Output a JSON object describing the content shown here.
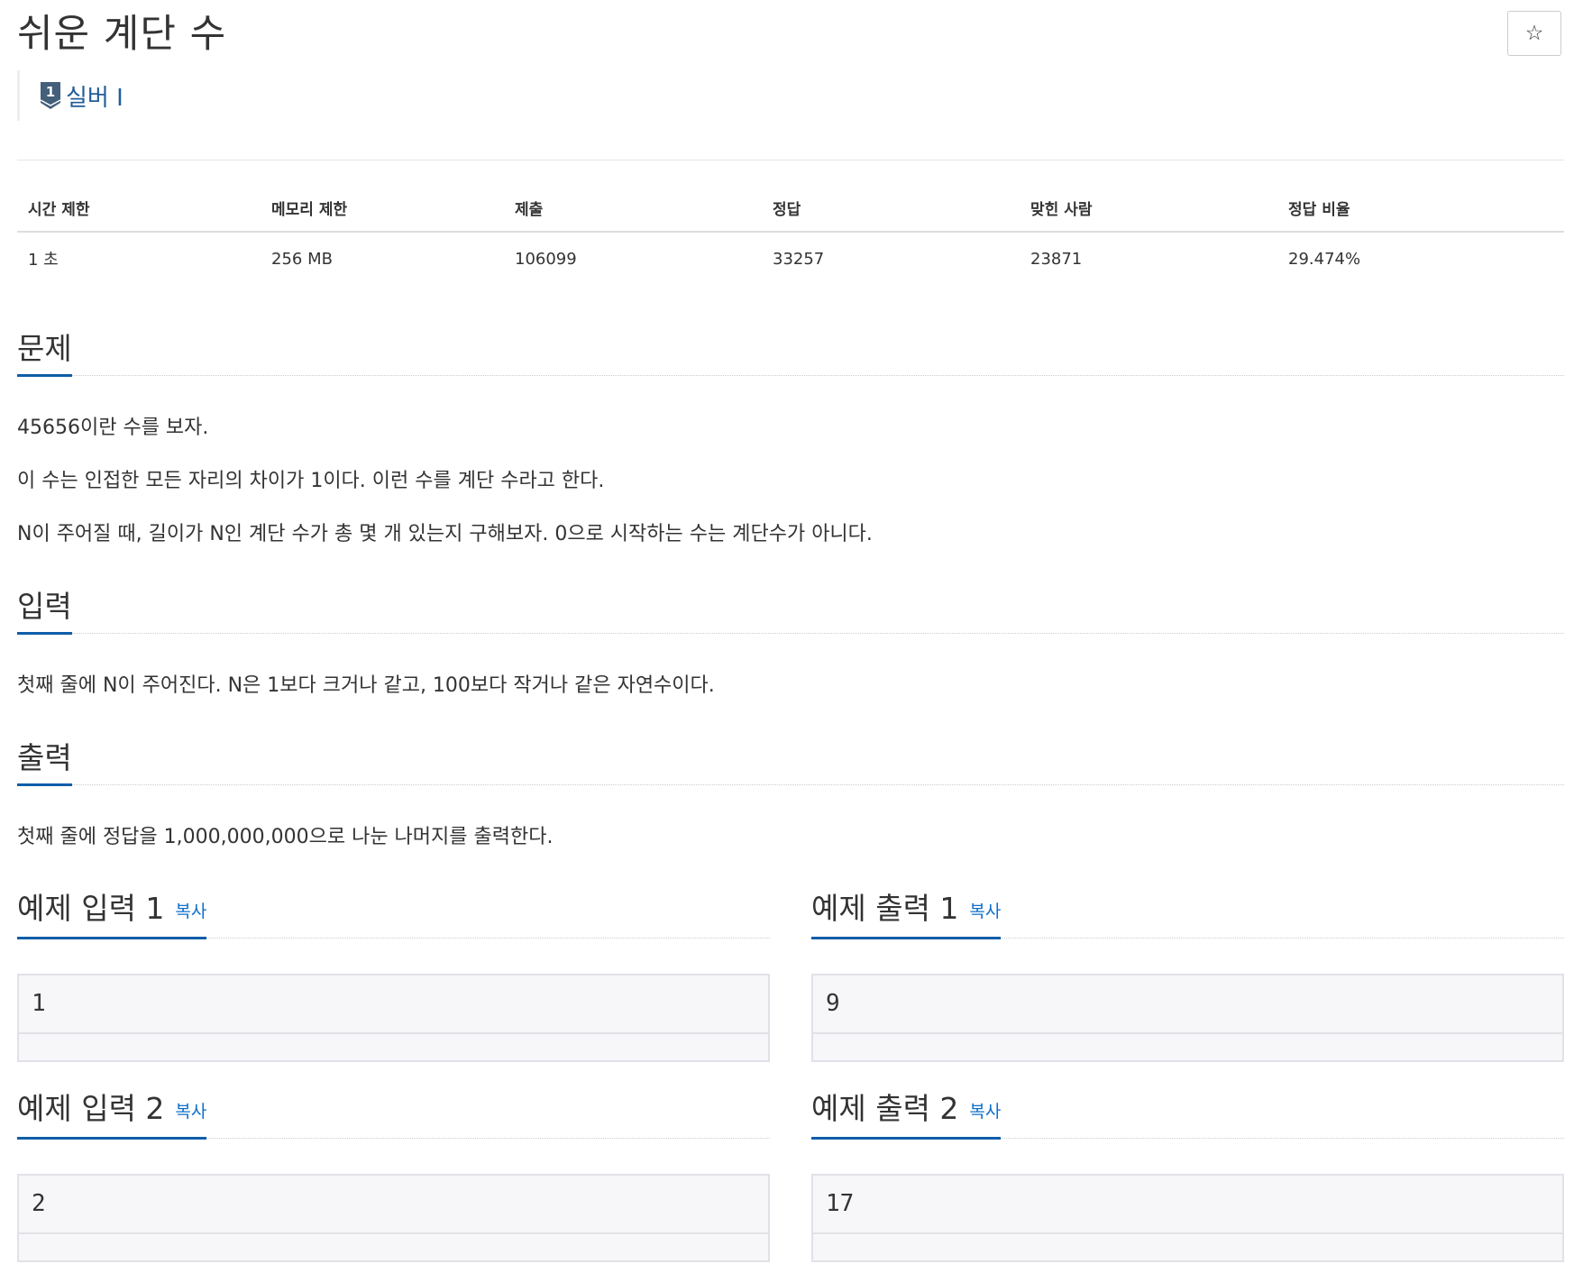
{
  "problem": {
    "title": "쉬운 계단 수",
    "tier_label": "실버 I",
    "tier_number": "1",
    "star_glyph": "☆",
    "star_icon": "star-outline-icon"
  },
  "stats": {
    "headers": [
      "시간 제한",
      "메모리 제한",
      "제출",
      "정답",
      "맞힌 사람",
      "정답 비율"
    ],
    "values": [
      "1 초",
      "256 MB",
      "106099",
      "33257",
      "23871",
      "29.474%"
    ]
  },
  "sections": {
    "problem": {
      "title": "문제",
      "lines": [
        "45656이란 수를 보자.",
        "이 수는 인접한 모든 자리의 차이가 1이다. 이런 수를 계단 수라고 한다.",
        "N이 주어질 때, 길이가 N인 계단 수가 총 몇 개 있는지 구해보자. 0으로 시작하는 수는 계단수가 아니다."
      ]
    },
    "input": {
      "title": "입력",
      "text": "첫째 줄에 N이 주어진다. N은 1보다 크거나 같고, 100보다 작거나 같은 자연수이다."
    },
    "output": {
      "title": "출력",
      "text": "첫째 줄에 정답을 1,000,000,000으로 나눈 나머지를 출력한다."
    }
  },
  "samples": {
    "copy_label": "복사",
    "input1": {
      "title": "예제 입력 1",
      "value": "1"
    },
    "output1": {
      "title": "예제 출력 1",
      "value": "9"
    },
    "input2": {
      "title": "예제 입력 2",
      "value": "2"
    },
    "output2": {
      "title": "예제 출력 2",
      "value": "17"
    }
  },
  "colors": {
    "accent": "#0e5ea8",
    "link": "#0e6fce",
    "tier_silver": "#435f7a"
  }
}
